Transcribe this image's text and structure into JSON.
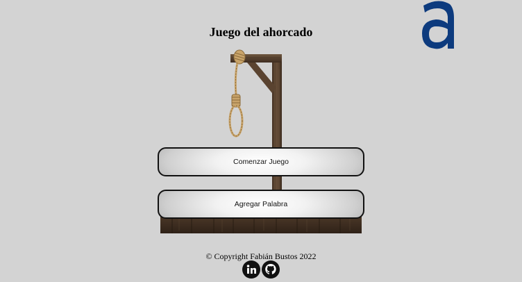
{
  "page": {
    "title": "Juego del ahorcado"
  },
  "logo": {
    "letter": "a",
    "color": "#0d3b7e"
  },
  "buttons": {
    "start": "Comenzar Juego",
    "add_word": "Agregar Palabra"
  },
  "footer": {
    "copyright": "© Copyright Fabián Bustos 2022",
    "social": [
      {
        "icon": "linkedin-icon"
      },
      {
        "icon": "github-icon"
      }
    ]
  },
  "colors": {
    "background": "#d3d3d3",
    "wood": "#5a4330",
    "rope": "#c9a46a",
    "button_border": "#111111"
  }
}
